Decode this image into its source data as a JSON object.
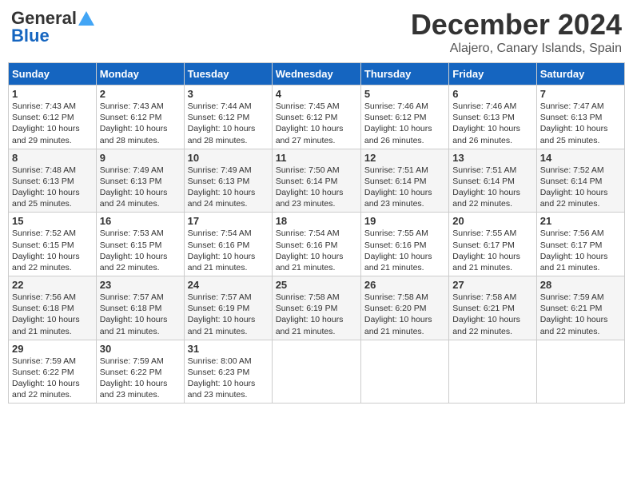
{
  "logo": {
    "line1": "General",
    "line2": "Blue"
  },
  "title": "December 2024",
  "subtitle": "Alajero, Canary Islands, Spain",
  "days_of_week": [
    "Sunday",
    "Monday",
    "Tuesday",
    "Wednesday",
    "Thursday",
    "Friday",
    "Saturday"
  ],
  "weeks": [
    [
      {
        "day": "1",
        "sunrise": "7:43 AM",
        "sunset": "6:12 PM",
        "daylight": "10 hours and 29 minutes."
      },
      {
        "day": "2",
        "sunrise": "7:43 AM",
        "sunset": "6:12 PM",
        "daylight": "10 hours and 28 minutes."
      },
      {
        "day": "3",
        "sunrise": "7:44 AM",
        "sunset": "6:12 PM",
        "daylight": "10 hours and 28 minutes."
      },
      {
        "day": "4",
        "sunrise": "7:45 AM",
        "sunset": "6:12 PM",
        "daylight": "10 hours and 27 minutes."
      },
      {
        "day": "5",
        "sunrise": "7:46 AM",
        "sunset": "6:12 PM",
        "daylight": "10 hours and 26 minutes."
      },
      {
        "day": "6",
        "sunrise": "7:46 AM",
        "sunset": "6:13 PM",
        "daylight": "10 hours and 26 minutes."
      },
      {
        "day": "7",
        "sunrise": "7:47 AM",
        "sunset": "6:13 PM",
        "daylight": "10 hours and 25 minutes."
      }
    ],
    [
      {
        "day": "8",
        "sunrise": "7:48 AM",
        "sunset": "6:13 PM",
        "daylight": "10 hours and 25 minutes."
      },
      {
        "day": "9",
        "sunrise": "7:49 AM",
        "sunset": "6:13 PM",
        "daylight": "10 hours and 24 minutes."
      },
      {
        "day": "10",
        "sunrise": "7:49 AM",
        "sunset": "6:13 PM",
        "daylight": "10 hours and 24 minutes."
      },
      {
        "day": "11",
        "sunrise": "7:50 AM",
        "sunset": "6:14 PM",
        "daylight": "10 hours and 23 minutes."
      },
      {
        "day": "12",
        "sunrise": "7:51 AM",
        "sunset": "6:14 PM",
        "daylight": "10 hours and 23 minutes."
      },
      {
        "day": "13",
        "sunrise": "7:51 AM",
        "sunset": "6:14 PM",
        "daylight": "10 hours and 22 minutes."
      },
      {
        "day": "14",
        "sunrise": "7:52 AM",
        "sunset": "6:14 PM",
        "daylight": "10 hours and 22 minutes."
      }
    ],
    [
      {
        "day": "15",
        "sunrise": "7:52 AM",
        "sunset": "6:15 PM",
        "daylight": "10 hours and 22 minutes."
      },
      {
        "day": "16",
        "sunrise": "7:53 AM",
        "sunset": "6:15 PM",
        "daylight": "10 hours and 22 minutes."
      },
      {
        "day": "17",
        "sunrise": "7:54 AM",
        "sunset": "6:16 PM",
        "daylight": "10 hours and 21 minutes."
      },
      {
        "day": "18",
        "sunrise": "7:54 AM",
        "sunset": "6:16 PM",
        "daylight": "10 hours and 21 minutes."
      },
      {
        "day": "19",
        "sunrise": "7:55 AM",
        "sunset": "6:16 PM",
        "daylight": "10 hours and 21 minutes."
      },
      {
        "day": "20",
        "sunrise": "7:55 AM",
        "sunset": "6:17 PM",
        "daylight": "10 hours and 21 minutes."
      },
      {
        "day": "21",
        "sunrise": "7:56 AM",
        "sunset": "6:17 PM",
        "daylight": "10 hours and 21 minutes."
      }
    ],
    [
      {
        "day": "22",
        "sunrise": "7:56 AM",
        "sunset": "6:18 PM",
        "daylight": "10 hours and 21 minutes."
      },
      {
        "day": "23",
        "sunrise": "7:57 AM",
        "sunset": "6:18 PM",
        "daylight": "10 hours and 21 minutes."
      },
      {
        "day": "24",
        "sunrise": "7:57 AM",
        "sunset": "6:19 PM",
        "daylight": "10 hours and 21 minutes."
      },
      {
        "day": "25",
        "sunrise": "7:58 AM",
        "sunset": "6:19 PM",
        "daylight": "10 hours and 21 minutes."
      },
      {
        "day": "26",
        "sunrise": "7:58 AM",
        "sunset": "6:20 PM",
        "daylight": "10 hours and 21 minutes."
      },
      {
        "day": "27",
        "sunrise": "7:58 AM",
        "sunset": "6:21 PM",
        "daylight": "10 hours and 22 minutes."
      },
      {
        "day": "28",
        "sunrise": "7:59 AM",
        "sunset": "6:21 PM",
        "daylight": "10 hours and 22 minutes."
      }
    ],
    [
      {
        "day": "29",
        "sunrise": "7:59 AM",
        "sunset": "6:22 PM",
        "daylight": "10 hours and 22 minutes."
      },
      {
        "day": "30",
        "sunrise": "7:59 AM",
        "sunset": "6:22 PM",
        "daylight": "10 hours and 23 minutes."
      },
      {
        "day": "31",
        "sunrise": "8:00 AM",
        "sunset": "6:23 PM",
        "daylight": "10 hours and 23 minutes."
      },
      null,
      null,
      null,
      null
    ]
  ]
}
